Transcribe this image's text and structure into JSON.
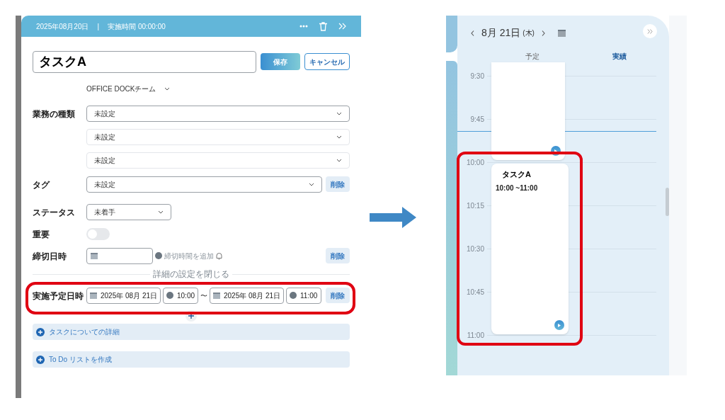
{
  "task_panel": {
    "header": {
      "date": "2025年08月20日",
      "separator": "|",
      "elapsed": "実施時間 00:00:00"
    },
    "title": "タスクA",
    "save": "保存",
    "cancel": "キャンセル",
    "team": "OFFICE DOCKチーム",
    "fields": [
      {
        "kind": "select",
        "label": "業務の種類",
        "value": "未設定"
      },
      {
        "kind": "select",
        "value": "未設定"
      },
      {
        "kind": "select",
        "value": "未設定"
      },
      {
        "kind": "select",
        "label": "タグ",
        "value": "未設定",
        "delete": "削除"
      },
      {
        "kind": "status",
        "label": "ステータス",
        "value": "未着手"
      },
      {
        "kind": "toggle",
        "label": "重要",
        "on": false
      },
      {
        "kind": "deadline",
        "label": "締切日時",
        "add_time": "締切時間を追加",
        "delete": "削除"
      }
    ],
    "details_toggle": "詳細の設定を閉じる",
    "schedule": {
      "label": "実施予定日時",
      "start_date": "2025年 08月 21日",
      "start_time": "10:00",
      "tilde": "〜",
      "end_date": "2025年 08月 21日",
      "end_time": "11:00",
      "delete": "削除"
    },
    "sections": [
      "タスクについての詳細",
      "To Do リストを作成"
    ]
  },
  "calendar": {
    "date": "8月 21日",
    "weekday": "(木)",
    "columns": [
      {
        "label": "予定",
        "selected": false
      },
      {
        "label": "実績",
        "selected": true
      }
    ],
    "times": [
      "9:30",
      "9:45",
      "10:00",
      "10:15",
      "10:30",
      "10:45",
      "11:00"
    ],
    "events": [
      {
        "title": "タスクA",
        "time": "10:00 ~11:00"
      }
    ]
  }
}
